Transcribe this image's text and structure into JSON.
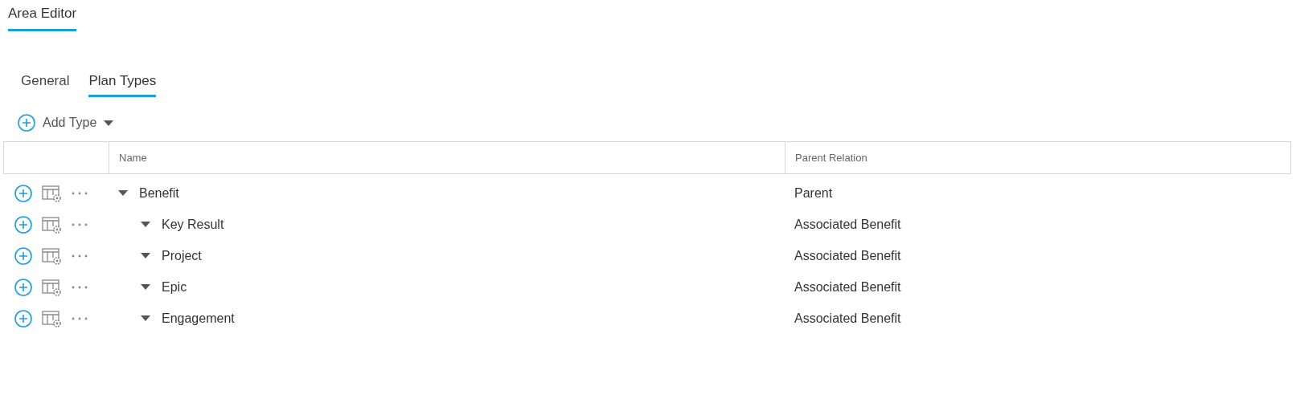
{
  "page_title": "Area Editor",
  "tabs": [
    {
      "label": "General",
      "selected": false
    },
    {
      "label": "Plan Types",
      "selected": true
    }
  ],
  "toolbar": {
    "add_button": "Add Type"
  },
  "table": {
    "columns": [
      "Name",
      "Parent Relation"
    ],
    "rows": [
      {
        "name": "Benefit",
        "parent_relation": "Parent",
        "expanded": true,
        "children": [
          {
            "name": "Key Result",
            "parent_relation": "Associated Benefit",
            "expanded": true
          },
          {
            "name": "Project",
            "parent_relation": "Associated Benefit",
            "expanded": true
          },
          {
            "name": "Epic",
            "parent_relation": "Associated Benefit",
            "expanded": true
          },
          {
            "name": "Engagement",
            "parent_relation": "Associated Benefit",
            "expanded": true
          }
        ]
      }
    ]
  }
}
